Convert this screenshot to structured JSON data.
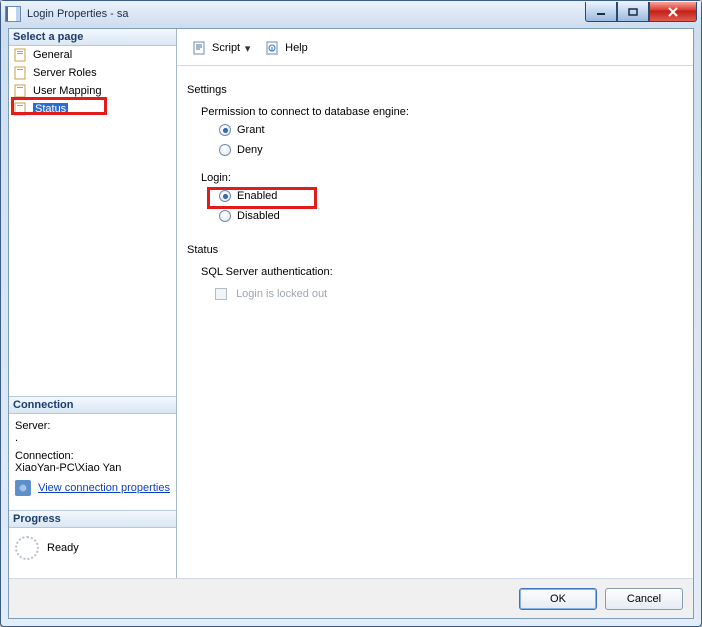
{
  "window": {
    "title": "Login Properties - sa"
  },
  "sidebar": {
    "header": "Select a page",
    "items": [
      {
        "label": "General"
      },
      {
        "label": "Server Roles"
      },
      {
        "label": "User Mapping"
      },
      {
        "label": "Status"
      }
    ],
    "selected_index": 3
  },
  "toolbar": {
    "script_label": "Script",
    "help_label": "Help"
  },
  "settings": {
    "title": "Settings",
    "perm_label": "Permission to connect to database engine:",
    "perm_grant": "Grant",
    "perm_deny": "Deny",
    "perm_value": "Grant",
    "login_label": "Login:",
    "login_enabled": "Enabled",
    "login_disabled": "Disabled",
    "login_value": "Enabled"
  },
  "status": {
    "title": "Status",
    "auth_label": "SQL Server authentication:",
    "locked_label": "Login is locked out",
    "locked_checked": false,
    "locked_enabled": false
  },
  "connection": {
    "header": "Connection",
    "server_label": "Server:",
    "server_value": ".",
    "conn_label": "Connection:",
    "conn_value": "XiaoYan-PC\\Xiao Yan",
    "view_props": "View connection properties"
  },
  "progress": {
    "header": "Progress",
    "status": "Ready"
  },
  "footer": {
    "ok": "OK",
    "cancel": "Cancel"
  }
}
